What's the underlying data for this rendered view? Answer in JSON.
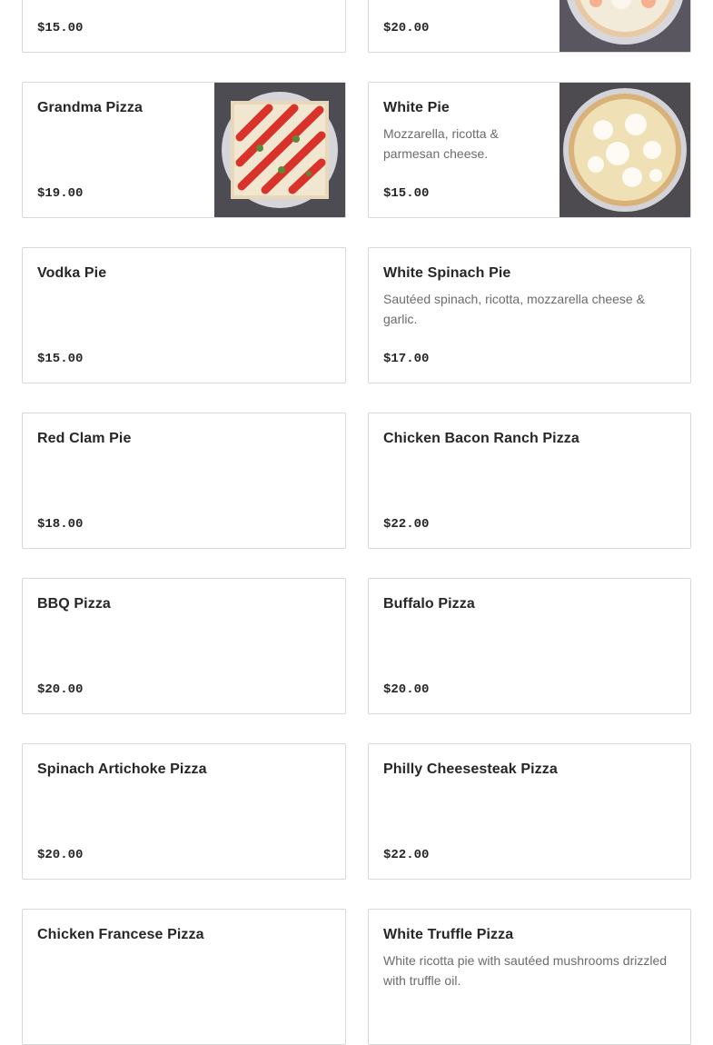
{
  "menu": {
    "items": [
      {
        "name": "",
        "description": "",
        "price": "$15.00",
        "image": ""
      },
      {
        "name": "",
        "description": "",
        "price": "$20.00",
        "image": "cheese-pizza-photo"
      },
      {
        "name": "Grandma Pizza",
        "description": "",
        "price": "$19.00",
        "image": "grandma-pizza-photo"
      },
      {
        "name": "White Pie",
        "description": "Mozzarella, ricotta & parmesan cheese.",
        "price": "$15.00",
        "image": "white-pie-photo"
      },
      {
        "name": "Vodka Pie",
        "description": "",
        "price": "$15.00",
        "image": ""
      },
      {
        "name": "White Spinach Pie",
        "description": "Sautéed spinach, ricotta, mozzarella cheese & garlic.",
        "price": "$17.00",
        "image": ""
      },
      {
        "name": "Red Clam Pie",
        "description": "",
        "price": "$18.00",
        "image": ""
      },
      {
        "name": "Chicken Bacon Ranch Pizza",
        "description": "",
        "price": "$22.00",
        "image": ""
      },
      {
        "name": "BBQ Pizza",
        "description": "",
        "price": "$20.00",
        "image": ""
      },
      {
        "name": "Buffalo Pizza",
        "description": "",
        "price": "$20.00",
        "image": ""
      },
      {
        "name": "Spinach Artichoke Pizza",
        "description": "",
        "price": "$20.00",
        "image": ""
      },
      {
        "name": "Philly Cheesesteak Pizza",
        "description": "",
        "price": "$22.00",
        "image": ""
      },
      {
        "name": "Chicken Francese Pizza",
        "description": "",
        "price": "",
        "image": ""
      },
      {
        "name": "White Truffle Pizza",
        "description": "White ricotta pie with sautéed mushrooms drizzled with truffle oil.",
        "price": "",
        "image": ""
      }
    ]
  }
}
